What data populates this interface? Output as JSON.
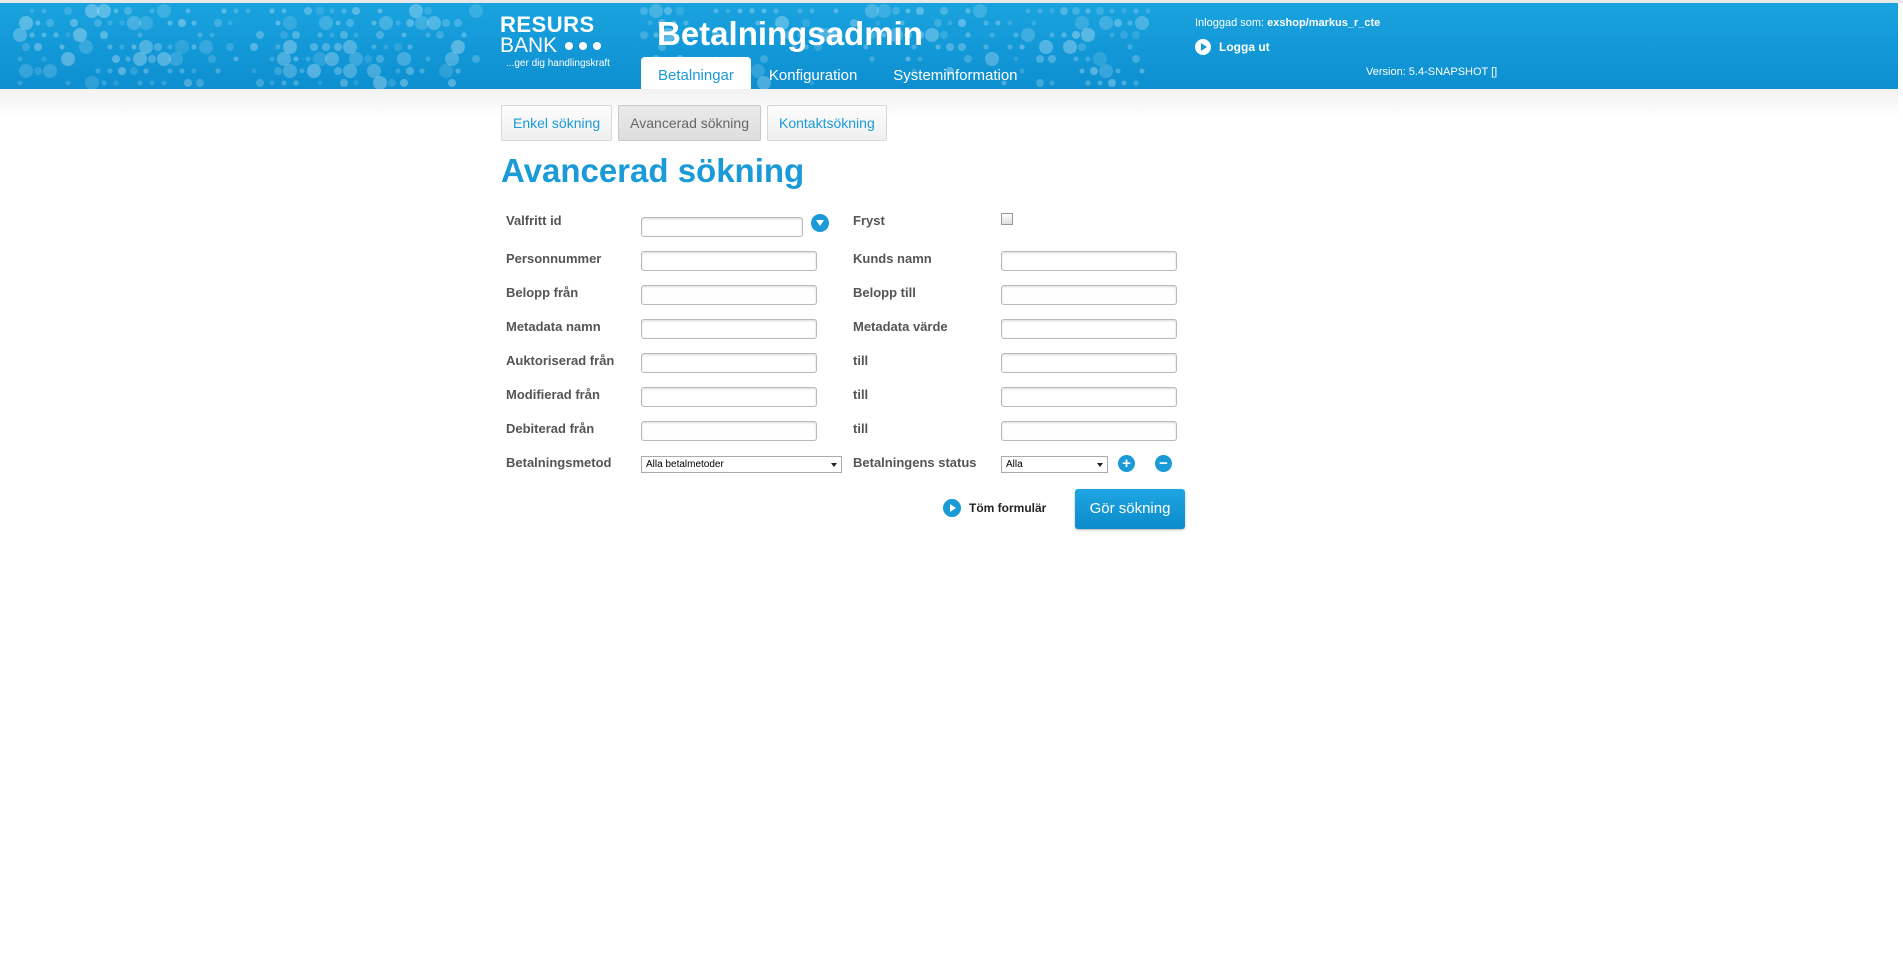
{
  "header": {
    "logo_line1": "RESURS",
    "logo_line2": "BANK",
    "tagline": "...ger dig handlingskraft",
    "app_title": "Betalningsadmin",
    "logged_in_label": "Inloggad som:",
    "logged_in_user": "exshop/markus_r_cte",
    "logout_label": "Logga ut",
    "version": "Version: 5.4-SNAPSHOT []",
    "nav": [
      "Betalningar",
      "Konfiguration",
      "Systeminformation"
    ],
    "active_nav": "Betalningar"
  },
  "subtabs": [
    "Enkel sökning",
    "Avancerad sökning",
    "Kontaktsökning"
  ],
  "active_subtab": "Avancerad sökning",
  "page_title": "Avancerad sökning",
  "form": {
    "valfritt_id": "Valfritt id",
    "fryst": "Fryst",
    "personnummer": "Personnummer",
    "kunds_namn": "Kunds namn",
    "belopp_fran": "Belopp från",
    "belopp_till": "Belopp till",
    "metadata_namn": "Metadata namn",
    "metadata_varde": "Metadata värde",
    "auktoriserad_fran": "Auktoriserad från",
    "modifierad_fran": "Modifierad från",
    "debiterad_fran": "Debiterad från",
    "till": "till",
    "betalningsmetod": "Betalningsmetod",
    "betalningsmetod_value": "Alla betalmetoder",
    "betalningens_status": "Betalningens status",
    "status_value": "Alla",
    "clear_label": "Töm formulär",
    "search_label": "Gör sökning"
  },
  "colors": {
    "brand_blue": "#1a9ad7"
  },
  "icons": [
    "play-icon",
    "chevron-down-icon",
    "plus-icon",
    "minus-icon"
  ]
}
